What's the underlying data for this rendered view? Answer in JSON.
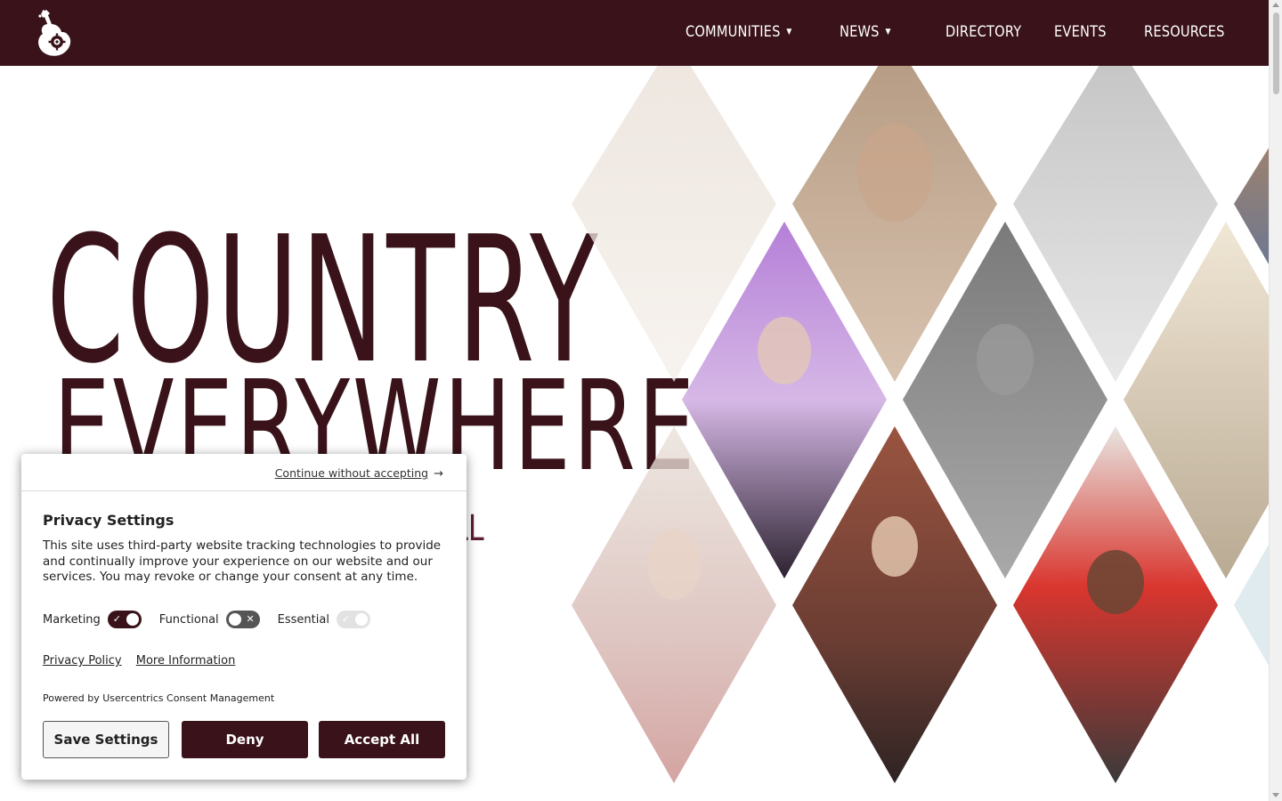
{
  "colors": {
    "brand": "#3a131a",
    "white": "#ffffff"
  },
  "header": {
    "logo_icon": "guitar-logo-icon",
    "nav": [
      {
        "label": "COMMUNITIES",
        "dropdown": true
      },
      {
        "label": "NEWS",
        "dropdown": true
      },
      {
        "label": "DIRECTORY",
        "dropdown": false
      },
      {
        "label": "EVENTS",
        "dropdown": false
      },
      {
        "label": "RESOURCES",
        "dropdown": false
      }
    ],
    "caret": "▼"
  },
  "hero": {
    "line1": "COUNTRY",
    "line2": "EVERYWHERE",
    "partial_text": "LL"
  },
  "consent": {
    "continue_label": "Continue without accepting",
    "continue_arrow": "→",
    "title": "Privacy Settings",
    "body": "This site uses third-party website tracking technologies to provide and continually improve your experience on our website and our services. You may revoke or change your consent at any time.",
    "toggles": [
      {
        "label": "Marketing",
        "state": "on",
        "mark": "✓"
      },
      {
        "label": "Functional",
        "state": "off",
        "mark": "✕"
      },
      {
        "label": "Essential",
        "state": "disabled",
        "mark": "✓"
      }
    ],
    "privacy_policy": "Privacy Policy",
    "more_information": "More Information",
    "powered_by": "Powered by Usercentrics Consent Management",
    "buttons": {
      "save": "Save Settings",
      "deny": "Deny",
      "accept": "Accept All"
    }
  }
}
